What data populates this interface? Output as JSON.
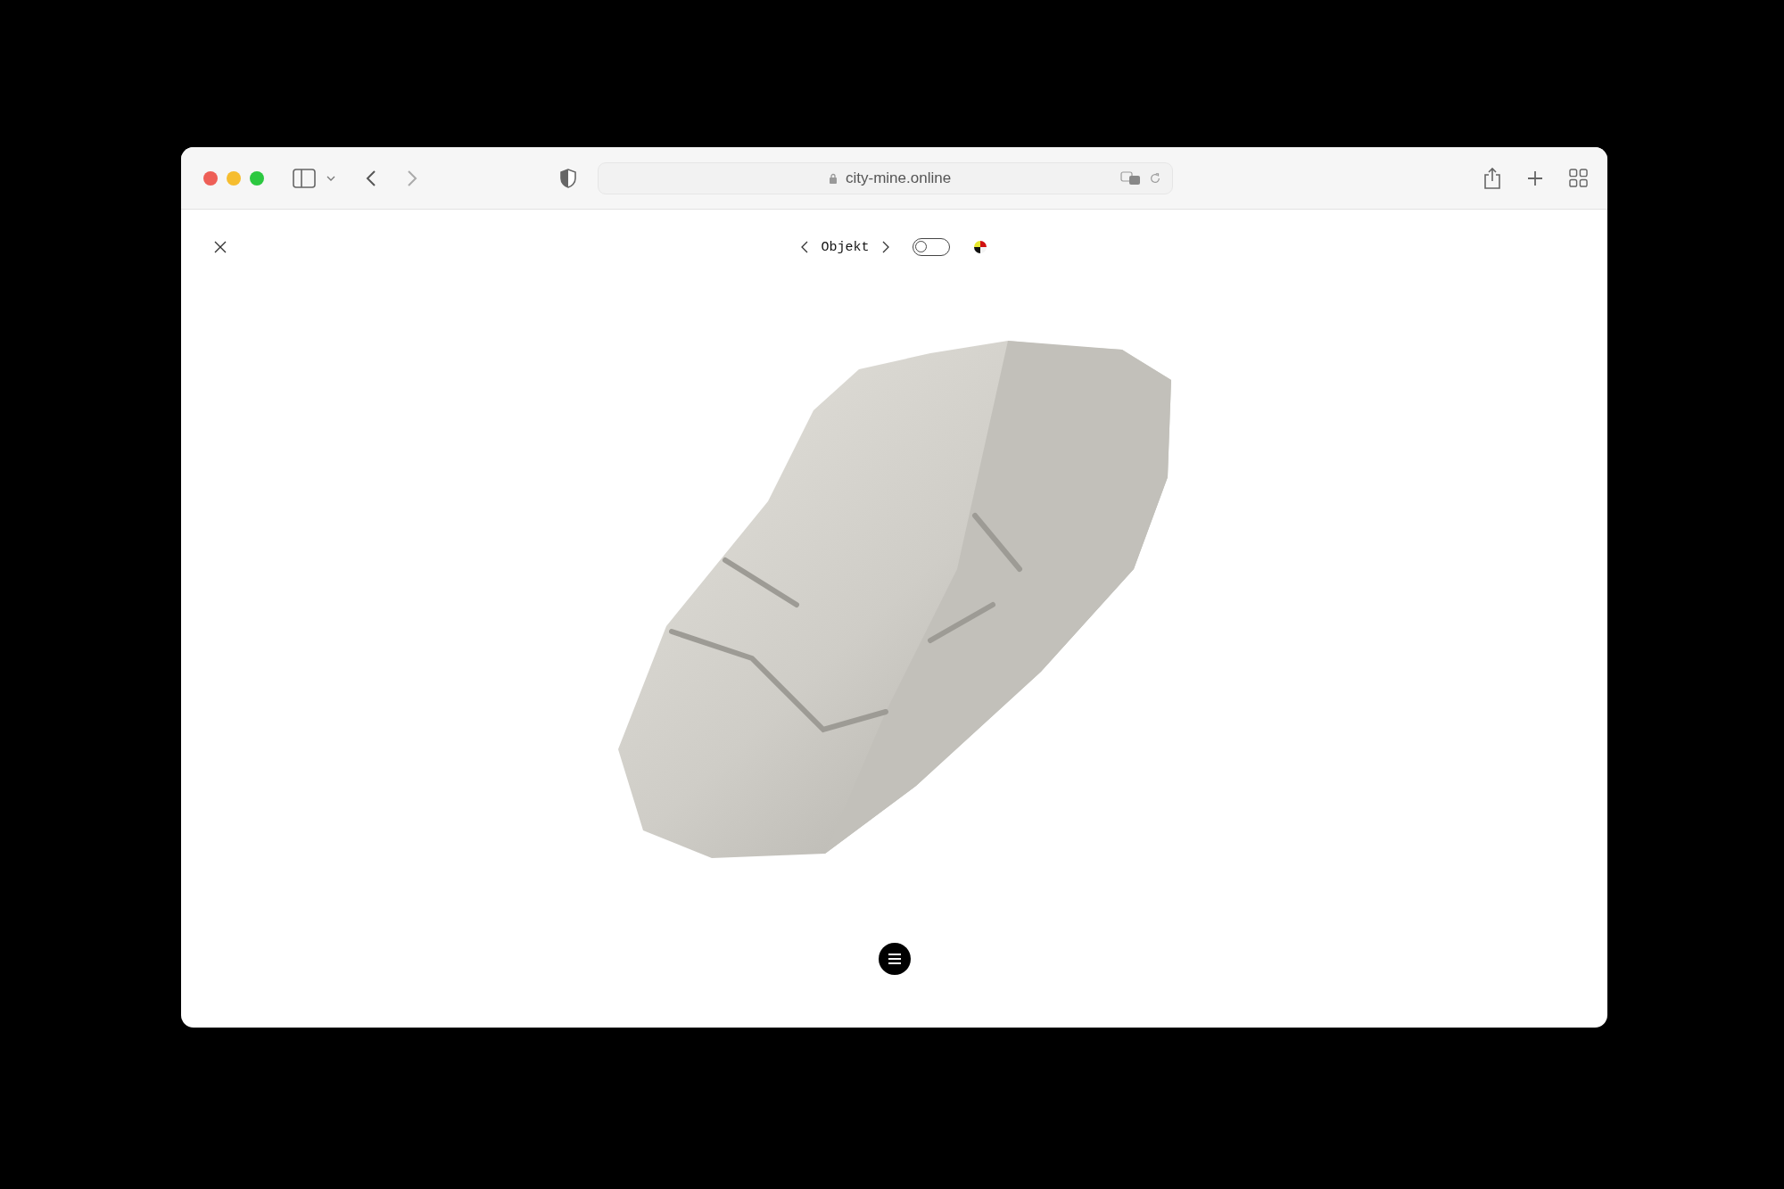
{
  "browser": {
    "url": "city-mine.online"
  },
  "viewer": {
    "nav_label": "Objekt",
    "toggle": {
      "on": false
    }
  }
}
